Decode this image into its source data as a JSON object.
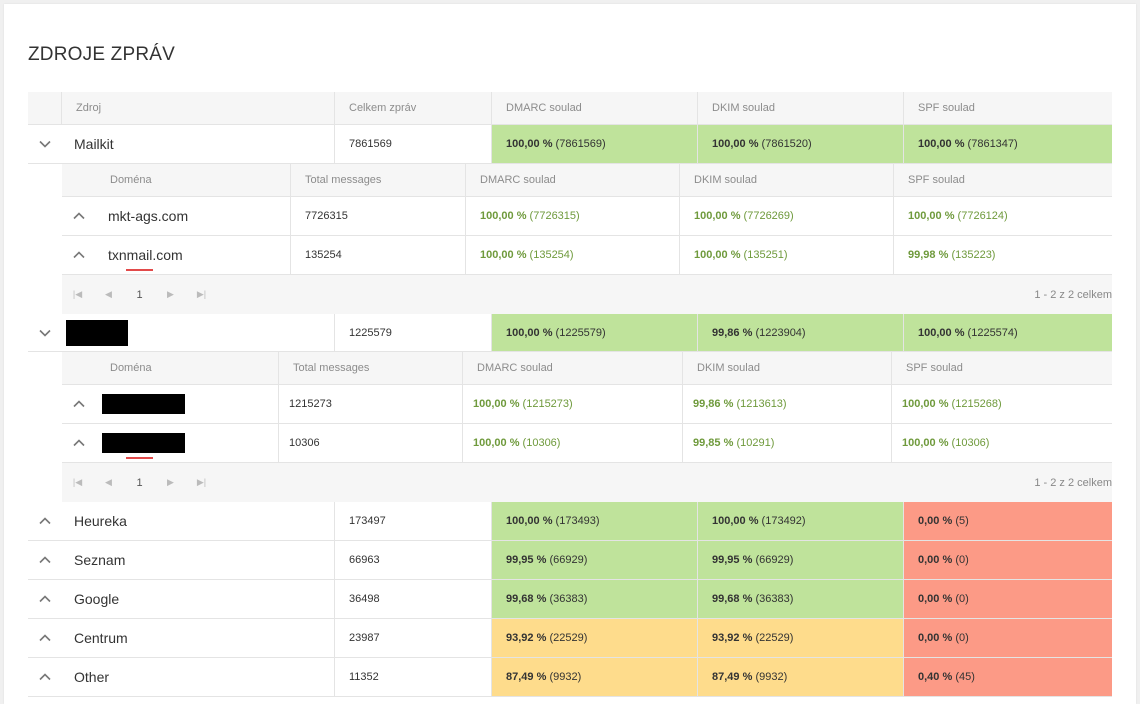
{
  "title": "ZDROJE ZPRÁV",
  "header": {
    "source": "Zdroj",
    "total": "Celkem zpráv",
    "dmarc": "DMARC soulad",
    "dkim": "DKIM soulad",
    "spf": "SPF soulad"
  },
  "nested_header": {
    "domain": "Doména",
    "total": "Total messages",
    "dmarc": "DMARC soulad",
    "dkim": "DKIM soulad",
    "spf": "SPF soulad"
  },
  "sources": [
    {
      "name": "Mailkit",
      "redacted": false,
      "expanded": true,
      "total": "7861569",
      "dmarc": {
        "pct": "100,00 %",
        "count": "(7861569)"
      },
      "dkim": {
        "pct": "100,00 %",
        "count": "(7861520)"
      },
      "spf": {
        "pct": "100,00 %",
        "count": "(7861347)"
      },
      "domains": [
        {
          "name": "mkt-ags.com",
          "total": "7726315",
          "dmarc": {
            "pct": "100,00 %",
            "count": "(7726315)"
          },
          "dkim": {
            "pct": "100,00 %",
            "count": "(7726269)"
          },
          "spf": {
            "pct": "100,00 %",
            "count": "(7726124)"
          }
        },
        {
          "name": "txnmail.com",
          "total": "135254",
          "dmarc": {
            "pct": "100,00 %",
            "count": "(135254)"
          },
          "dkim": {
            "pct": "100,00 %",
            "count": "(135251)"
          },
          "spf": {
            "pct": "99,98 %",
            "count": "(135223)"
          }
        }
      ],
      "pager": {
        "page": "1",
        "info": "1 - 2 z 2 celkem"
      }
    },
    {
      "name": "",
      "redacted": true,
      "expanded": true,
      "total": "1225579",
      "dmarc": {
        "pct": "100,00 %",
        "count": "(1225579)"
      },
      "dkim": {
        "pct": "99,86 %",
        "count": "(1223904)"
      },
      "spf": {
        "pct": "100,00 %",
        "count": "(1225574)"
      },
      "domains": [
        {
          "name": "",
          "redacted": true,
          "total": "1215273",
          "dmarc": {
            "pct": "100,00 %",
            "count": "(1215273)"
          },
          "dkim": {
            "pct": "99,86 %",
            "count": "(1213613)"
          },
          "spf": {
            "pct": "100,00 %",
            "count": "(1215268)"
          }
        },
        {
          "name": "",
          "redacted": true,
          "total": "10306",
          "dmarc": {
            "pct": "100,00 %",
            "count": "(10306)"
          },
          "dkim": {
            "pct": "99,85 %",
            "count": "(10291)"
          },
          "spf": {
            "pct": "100,00 %",
            "count": "(10306)"
          }
        }
      ],
      "pager": {
        "page": "1",
        "info": "1 - 2 z 2 celkem"
      }
    },
    {
      "name": "Heureka",
      "total": "173497",
      "dmarc": {
        "pct": "100,00 %",
        "count": "(173493)",
        "color": "green"
      },
      "dkim": {
        "pct": "100,00 %",
        "count": "(173492)",
        "color": "green"
      },
      "spf": {
        "pct": "0,00 %",
        "count": "(5)",
        "color": "red"
      }
    },
    {
      "name": "Seznam",
      "total": "66963",
      "dmarc": {
        "pct": "99,95 %",
        "count": "(66929)",
        "color": "green"
      },
      "dkim": {
        "pct": "99,95 %",
        "count": "(66929)",
        "color": "green"
      },
      "spf": {
        "pct": "0,00 %",
        "count": "(0)",
        "color": "red"
      }
    },
    {
      "name": "Google",
      "total": "36498",
      "dmarc": {
        "pct": "99,68 %",
        "count": "(36383)",
        "color": "green"
      },
      "dkim": {
        "pct": "99,68 %",
        "count": "(36383)",
        "color": "green"
      },
      "spf": {
        "pct": "0,00 %",
        "count": "(0)",
        "color": "red"
      }
    },
    {
      "name": "Centrum",
      "total": "23987",
      "dmarc": {
        "pct": "93,92 %",
        "count": "(22529)",
        "color": "yellow"
      },
      "dkim": {
        "pct": "93,92 %",
        "count": "(22529)",
        "color": "yellow"
      },
      "spf": {
        "pct": "0,00 %",
        "count": "(0)",
        "color": "red"
      }
    },
    {
      "name": "Other",
      "total": "11352",
      "dmarc": {
        "pct": "87,49 %",
        "count": "(9932)",
        "color": "yellow"
      },
      "dkim": {
        "pct": "87,49 %",
        "count": "(9932)",
        "color": "yellow"
      },
      "spf": {
        "pct": "0,40 %",
        "count": "(45)",
        "color": "red"
      }
    }
  ],
  "colors": {
    "green": "#bfe39b",
    "yellow": "#fedc8c",
    "red": "#fc9a86",
    "pager_accent": "#e24a4a"
  },
  "icons": {
    "expanded": "chevron-down-icon",
    "collapsed": "chevron-up-icon",
    "pager": [
      "first-page-icon",
      "prev-page-icon",
      "next-page-icon",
      "last-page-icon"
    ]
  }
}
